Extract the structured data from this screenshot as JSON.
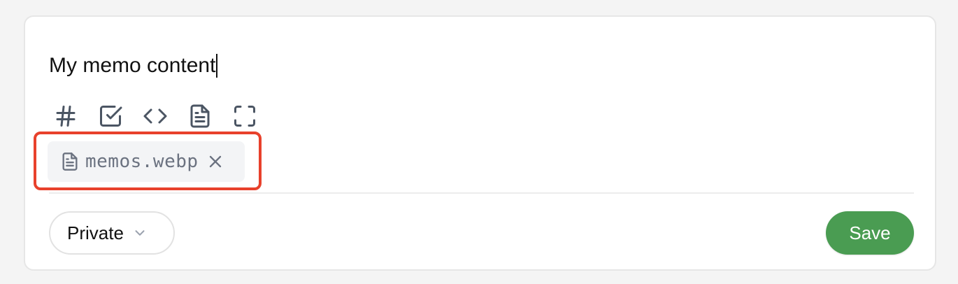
{
  "editor": {
    "content": "My memo content"
  },
  "toolbar": {
    "tools": [
      {
        "name": "tag",
        "icon": "hash-icon"
      },
      {
        "name": "checkbox",
        "icon": "square-check-icon"
      },
      {
        "name": "code",
        "icon": "code-icon"
      },
      {
        "name": "file",
        "icon": "file-text-icon"
      },
      {
        "name": "fullscreen",
        "icon": "maximize-icon"
      }
    ]
  },
  "attachment": {
    "filename": "memos.webp",
    "icon": "file-text-icon",
    "remove_icon": "close-icon",
    "highlight_color": "#e8412c"
  },
  "footer": {
    "visibility_label": "Private",
    "visibility_icon": "chevron-down-icon",
    "save_label": "Save",
    "save_color": "#4a9c52"
  }
}
